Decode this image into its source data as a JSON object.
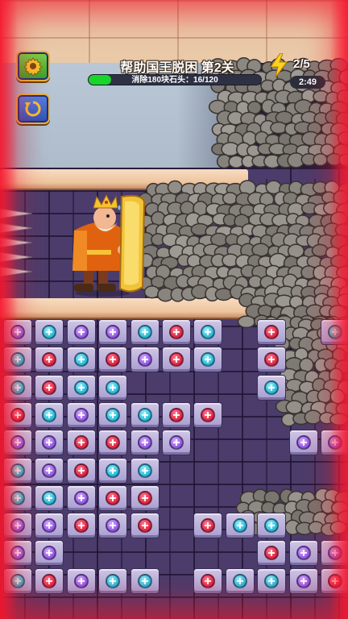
{
  "hud": {
    "title": "帮助国王脱困 第2关",
    "progress_label": "消除180块石头：16/120",
    "progress_fraction": 0.133,
    "energy": "2/5",
    "timer": "2:49"
  },
  "icons": {
    "settings": "gear-icon",
    "restart": "restart-icon",
    "energy": "lightning-icon"
  },
  "colors": {
    "screw_red": "#e0203c",
    "screw_cyan": "#1fb7d6",
    "screw_purple": "#8f52e6",
    "progress_fill": "#19d42a",
    "alert_vignette": "#f01428"
  },
  "board": {
    "rows": [
      [
        "purple",
        "cyan",
        "purple",
        "purple",
        "cyan",
        "red",
        "cyan",
        null,
        "red",
        null,
        "cyan"
      ],
      [
        "cyan",
        "red",
        "cyan",
        "red",
        "purple",
        "red",
        "cyan",
        null,
        "red",
        null,
        null
      ],
      [
        "cyan",
        "red",
        "cyan",
        "cyan",
        null,
        null,
        null,
        null,
        "cyan",
        null,
        null
      ],
      [
        "red",
        "cyan",
        "purple",
        "cyan",
        "cyan",
        "red",
        "red",
        null,
        null,
        null,
        null
      ],
      [
        "purple",
        "purple",
        "red",
        "red",
        "purple",
        "purple",
        null,
        null,
        null,
        "purple",
        "purple"
      ],
      [
        "cyan",
        "purple",
        "red",
        "cyan",
        "cyan",
        null,
        null,
        null,
        null,
        null,
        null
      ],
      [
        "cyan",
        "cyan",
        "purple",
        "red",
        "red",
        null,
        null,
        null,
        null,
        null,
        null
      ],
      [
        "purple",
        "purple",
        "red",
        "purple",
        "red",
        null,
        "red",
        "cyan",
        "cyan",
        null,
        null
      ],
      [
        "purple",
        "purple",
        null,
        null,
        null,
        null,
        null,
        null,
        "red",
        "purple",
        "purple"
      ],
      [
        "cyan",
        "red",
        "purple",
        "cyan",
        "cyan",
        null,
        "red",
        "cyan",
        "cyan",
        "purple",
        "red"
      ]
    ]
  }
}
